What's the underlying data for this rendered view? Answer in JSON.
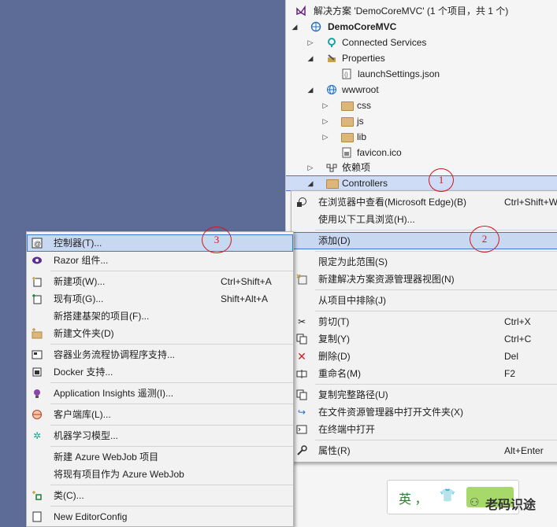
{
  "solution_explorer": {
    "solution_label": "解决方案 'DemoCoreMVC' (1 个项目，共 1 个)",
    "project": "DemoCoreMVC",
    "nodes": {
      "connected_services": "Connected Services",
      "properties": "Properties",
      "launch_settings": "launchSettings.json",
      "wwwroot": "wwwroot",
      "css": "css",
      "js": "js",
      "lib": "lib",
      "favicon": "favicon.ico",
      "dependencies": "依赖项",
      "controllers": "Controllers"
    }
  },
  "context_menu": {
    "view_in_browser": {
      "label": "在浏览器中查看(Microsoft Edge)(B)",
      "shortcut": "Ctrl+Shift+W"
    },
    "browse_with": {
      "label": "使用以下工具浏览(H)..."
    },
    "add": {
      "label": "添加(D)"
    },
    "scope_to_this": {
      "label": "限定为此范围(S)"
    },
    "new_solution_view": {
      "label": "新建解决方案资源管理器视图(N)"
    },
    "exclude": {
      "label": "从项目中排除(J)"
    },
    "cut": {
      "label": "剪切(T)",
      "shortcut": "Ctrl+X"
    },
    "copy": {
      "label": "复制(Y)",
      "shortcut": "Ctrl+C"
    },
    "delete": {
      "label": "删除(D)",
      "shortcut": "Del"
    },
    "rename": {
      "label": "重命名(M)",
      "shortcut": "F2"
    },
    "copy_full_path": {
      "label": "复制完整路径(U)"
    },
    "open_in_explorer": {
      "label": "在文件资源管理器中打开文件夹(X)"
    },
    "open_in_terminal": {
      "label": "在终端中打开"
    },
    "properties": {
      "label": "属性(R)",
      "shortcut": "Alt+Enter"
    }
  },
  "add_submenu": {
    "controller": {
      "label": "控制器(T)..."
    },
    "razor_component": {
      "label": "Razor 组件..."
    },
    "new_item": {
      "label": "新建项(W)...",
      "shortcut": "Ctrl+Shift+A"
    },
    "existing_item": {
      "label": "现有项(G)...",
      "shortcut": "Shift+Alt+A"
    },
    "new_scaffolded_item": {
      "label": "新搭建基架的项目(F)..."
    },
    "new_folder": {
      "label": "新建文件夹(D)"
    },
    "container_orchestration": {
      "label": "容器业务流程协调程序支持..."
    },
    "docker_support": {
      "label": "Docker 支持..."
    },
    "app_insights": {
      "label": "Application Insights 遥测(I)..."
    },
    "client_library": {
      "label": "客户端库(L)..."
    },
    "ml_model": {
      "label": "机器学习模型..."
    },
    "new_azure_webjob": {
      "label": "新建 Azure WebJob 项目"
    },
    "existing_as_webjob": {
      "label": "将现有项目作为 Azure WebJob"
    },
    "class": {
      "label": "类(C)..."
    },
    "new_editorconfig": {
      "label": "New EditorConfig"
    }
  },
  "annotations": {
    "one": "1",
    "two": "2",
    "three": "3"
  },
  "ime_bar": {
    "text": "英 ，"
  },
  "watermark": {
    "text": "老码识途"
  },
  "colors": {
    "highlight": "#c9d8f1",
    "highlight_border": "#3c79d4",
    "annotation": "#d4161c",
    "background": "#5d6b97"
  }
}
